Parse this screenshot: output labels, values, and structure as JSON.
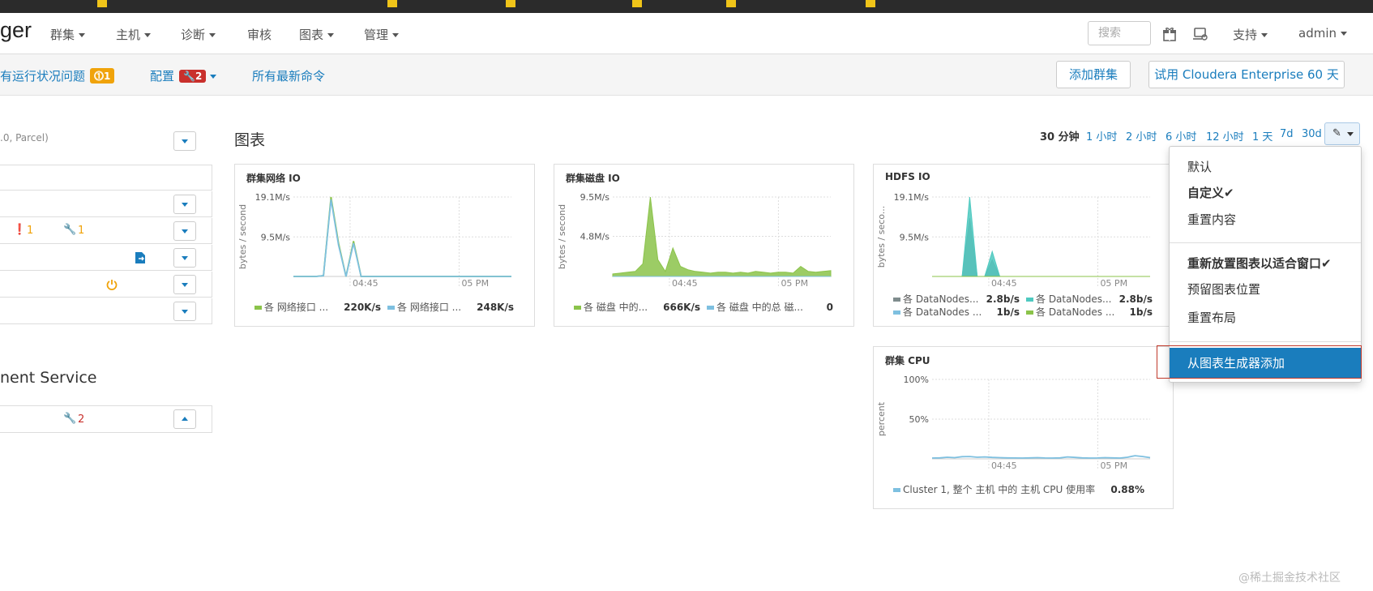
{
  "navbar": {
    "brand": "ger",
    "items": [
      {
        "label": "群集",
        "caret": true
      },
      {
        "label": "主机",
        "caret": true
      },
      {
        "label": "诊断",
        "caret": true
      },
      {
        "label": "审核",
        "caret": false
      },
      {
        "label": "图表",
        "caret": true
      },
      {
        "label": "管理",
        "caret": true
      }
    ],
    "search_placeholder": "搜索",
    "support": "支持",
    "user": "admin"
  },
  "subbar": {
    "health_link": "有运行状况问题",
    "health_count": "1",
    "config_link": "配置",
    "config_count": "2",
    "commands_link": "所有最新命令",
    "add_cluster_button": "添加群集",
    "trial_button": "试用 Cloudera Enterprise 60 天"
  },
  "left_panel": {
    "cluster_subtitle": ".0, Parcel)",
    "row_badges": {
      "warn_count": "1",
      "wrench_count": "1"
    },
    "section_title": "nent Service",
    "section_wrench_count": "2"
  },
  "charts_panel": {
    "title": "图表",
    "time_ranges": [
      "30 分钟",
      "1 小时",
      "2 小时",
      "6 小时",
      "12 小时",
      "1 天",
      "7d",
      "30d"
    ],
    "active_range": "30 分钟"
  },
  "chart_data": [
    {
      "type": "line",
      "title": "群集网络 IO",
      "ylabel": "bytes / second",
      "ytick_labels": [
        "19.1M/s",
        "9.5M/s"
      ],
      "xtick_labels": [
        "04:45",
        "05 PM"
      ],
      "series": [
        {
          "name": "各 网络接口 ...",
          "value_label": "220K/s",
          "color": "#8bc34a",
          "values": [
            0,
            0,
            0,
            0,
            0.2,
            19.1,
            8,
            0,
            8.5,
            0,
            0,
            0,
            0,
            0,
            0,
            0,
            0,
            0,
            0,
            0,
            0,
            0,
            0,
            0,
            0,
            0,
            0,
            0,
            0,
            0
          ]
        },
        {
          "name": "各 网络接口 ...",
          "value_label": "248K/s",
          "color": "#7ec0e0",
          "values": [
            0,
            0,
            0,
            0,
            0.2,
            18.5,
            7.5,
            0,
            8,
            0,
            0,
            0,
            0,
            0,
            0,
            0,
            0,
            0,
            0,
            0,
            0,
            0,
            0,
            0,
            0,
            0,
            0,
            0,
            0,
            0
          ]
        }
      ]
    },
    {
      "type": "area",
      "title": "群集磁盘 IO",
      "ylabel": "bytes / second",
      "ytick_labels": [
        "9.5M/s",
        "4.8M/s"
      ],
      "xtick_labels": [
        "04:45",
        "05 PM"
      ],
      "series": [
        {
          "name": "各 磁盘 中的...",
          "value_label": "666K/s",
          "color": "#8bc34a",
          "values": [
            0.3,
            0.4,
            0.5,
            0.6,
            1.5,
            9.5,
            2,
            0.6,
            3.4,
            1.2,
            0.8,
            0.6,
            0.5,
            0.4,
            0.5,
            0.5,
            0.4,
            0.5,
            0.4,
            0.6,
            0.5,
            0.4,
            0.5,
            0.5,
            0.4,
            1.2,
            0.6,
            0.5,
            0.6,
            0.7
          ]
        },
        {
          "name": "各 磁盘 中的总 磁...",
          "value_label": "0",
          "color": "#7ec0e0",
          "values": [
            0,
            0,
            0,
            0,
            0,
            0,
            0,
            0,
            0,
            0,
            0,
            0,
            0,
            0,
            0,
            0,
            0,
            0,
            0,
            0,
            0,
            0,
            0,
            0,
            0,
            0,
            0,
            0,
            0,
            0
          ]
        }
      ]
    },
    {
      "type": "area",
      "title": "HDFS IO",
      "ylabel": "bytes / seco...",
      "ytick_labels": [
        "19.1M/s",
        "9.5M/s"
      ],
      "xtick_labels": [
        "04:45",
        "05 PM"
      ],
      "series": [
        {
          "name": "各 DataNodes...",
          "value_label": "2.8b/s",
          "color": "#7f8c8d",
          "values": [
            0,
            0,
            0,
            0,
            0,
            14,
            0,
            0,
            4,
            0,
            0,
            0,
            0,
            0,
            0,
            0,
            0,
            0,
            0,
            0,
            0,
            0,
            0,
            0,
            0,
            0,
            0,
            0,
            0,
            0
          ]
        },
        {
          "name": "各 DataNodes...",
          "value_label": "2.8b/s",
          "color": "#4ec9c0",
          "values": [
            0,
            0,
            0,
            0,
            0,
            19.1,
            0,
            0,
            6,
            0,
            0,
            0,
            0,
            0,
            0,
            0,
            0,
            0,
            0,
            0,
            0,
            0,
            0,
            0,
            0,
            0,
            0,
            0,
            0,
            0
          ]
        },
        {
          "name": "各 DataNodes ...",
          "value_label": "1b/s",
          "color": "#7ec0e0",
          "values": [
            0,
            0,
            0,
            0,
            0,
            0,
            0,
            0,
            0,
            0,
            0,
            0,
            0,
            0,
            0,
            0,
            0,
            0,
            0,
            0,
            0,
            0,
            0,
            0,
            0,
            0,
            0,
            0,
            0,
            0
          ]
        },
        {
          "name": "各 DataNodes ...",
          "value_label": "1b/s",
          "color": "#8bc34a",
          "values": [
            0,
            0,
            0,
            0,
            0,
            0,
            0,
            0,
            0,
            0,
            0,
            0,
            0,
            0,
            0,
            0,
            0,
            0,
            0,
            0,
            0,
            0,
            0,
            0,
            0,
            0,
            0,
            0,
            0,
            0
          ]
        }
      ]
    },
    {
      "type": "line",
      "title": "群集 CPU",
      "ylabel": "percent",
      "ytick_labels": [
        "100%",
        "50%"
      ],
      "xtick_labels": [
        "04:45",
        "05 PM"
      ],
      "series": [
        {
          "name": "Cluster 1, 整个 主机 中的 主机 CPU 使用率",
          "value_label": "0.88%",
          "color": "#7ec0e0",
          "values": [
            1,
            1.2,
            2,
            1.5,
            2.8,
            3,
            2,
            2.5,
            1.8,
            1.5,
            1.2,
            1.1,
            1,
            1.2,
            1.5,
            1.1,
            1,
            1.2,
            2.5,
            1.8,
            1.2,
            1,
            1.1,
            1.5,
            1.2,
            1,
            2,
            4,
            3,
            1.5
          ]
        }
      ]
    }
  ],
  "dropdown_menu": {
    "items": [
      {
        "label": "默认",
        "bold": false,
        "check": false
      },
      {
        "label": "自定义",
        "bold": true,
        "check": true
      },
      {
        "label": "重置内容",
        "bold": false,
        "check": false
      },
      {
        "label": "重新放置图表以适合窗口",
        "bold": true,
        "check": true
      },
      {
        "label": "预留图表位置",
        "bold": false,
        "check": false
      },
      {
        "label": "重置布局",
        "bold": false,
        "check": false
      }
    ],
    "highlighted": "从图表生成器添加",
    "check_glyph": "✔"
  },
  "watermark": "@稀土掘金技术社区"
}
